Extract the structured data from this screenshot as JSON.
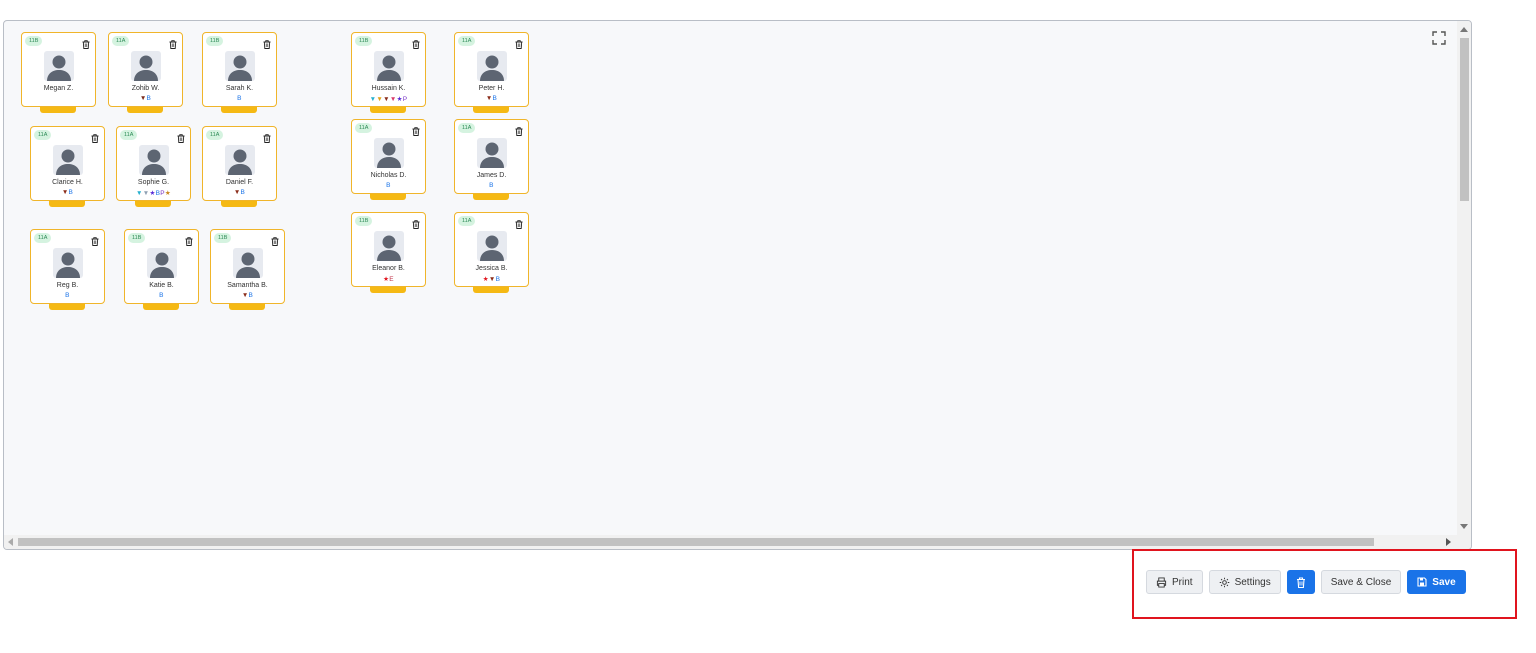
{
  "footer": {
    "print_label": "Print",
    "settings_label": "Settings",
    "delete_label": "",
    "save_close_label": "Save & Close",
    "save_label": "Save"
  },
  "icons": {
    "fullscreen": "fullscreen-icon",
    "trash": "trash-icon",
    "print": "printer-icon",
    "settings": "gear-icon",
    "save": "floppy-disk-icon",
    "avatar": "person-silhouette-icon"
  },
  "colors": {
    "card_border": "#f0b52a",
    "card_tab": "#f5b914",
    "class_badge_bg": "#d5f3e0",
    "class_badge_text": "#2c8a55",
    "primary_button": "#1a73e8",
    "highlight_box": "#e0141e",
    "tag_b": "#1a73e8",
    "tag_p": "#7a35c6",
    "tag_e": "#c0334a"
  },
  "students": [
    {
      "class": "11B",
      "name": "Megan Z.",
      "tags": []
    },
    {
      "class": "11A",
      "name": "Zohib W.",
      "tags": [
        {
          "t": "▼",
          "c": "#7a2b1c"
        },
        {
          "t": "B",
          "c": "#1a73e8"
        }
      ]
    },
    {
      "class": "11B",
      "name": "Sarah K.",
      "tags": [
        {
          "t": "B",
          "c": "#1a73e8"
        }
      ]
    },
    {
      "class": "11B",
      "name": "Hussain K.",
      "tags": [
        {
          "t": "▼",
          "c": "#27b0cf"
        },
        {
          "t": "▼",
          "c": "#e3a319"
        },
        {
          "t": "▼",
          "c": "#8a2c1a"
        },
        {
          "t": "▼",
          "c": "#d83a6a"
        },
        {
          "t": "★",
          "c": "#5a2bd6"
        },
        {
          "t": "P",
          "c": "#7a35c6"
        }
      ]
    },
    {
      "class": "11A",
      "name": "Peter H.",
      "tags": [
        {
          "t": "▼",
          "c": "#8a2c1a"
        },
        {
          "t": "B",
          "c": "#1a73e8"
        }
      ]
    },
    {
      "class": "11A",
      "name": "Clarice H.",
      "tags": [
        {
          "t": "▼",
          "c": "#8a2c1a"
        },
        {
          "t": "B",
          "c": "#1a73e8"
        }
      ]
    },
    {
      "class": "11A",
      "name": "Sophie G.",
      "tags": [
        {
          "t": "▼",
          "c": "#27b0cf"
        },
        {
          "t": "▼",
          "c": "#8fa0b3"
        },
        {
          "t": "★",
          "c": "#5a2bd6"
        },
        {
          "t": "B",
          "c": "#1a73e8"
        },
        {
          "t": "P",
          "c": "#7a35c6"
        },
        {
          "t": "★",
          "c": "#c8861d"
        }
      ]
    },
    {
      "class": "11A",
      "name": "Daniel F.",
      "tags": [
        {
          "t": "▼",
          "c": "#8a2c1a"
        },
        {
          "t": "B",
          "c": "#1a73e8"
        }
      ]
    },
    {
      "class": "11A",
      "name": "Nicholas D.",
      "tags": [
        {
          "t": "B",
          "c": "#1a73e8"
        }
      ]
    },
    {
      "class": "11A",
      "name": "James D.",
      "tags": [
        {
          "t": "B",
          "c": "#1a73e8"
        }
      ]
    },
    {
      "class": "11A",
      "name": "Reg B.",
      "tags": [
        {
          "t": "B",
          "c": "#1a73e8"
        }
      ]
    },
    {
      "class": "11B",
      "name": "Katie B.",
      "tags": [
        {
          "t": "B",
          "c": "#1a73e8"
        }
      ]
    },
    {
      "class": "11B",
      "name": "Samantha B.",
      "tags": [
        {
          "t": "▼",
          "c": "#8a2c1a"
        },
        {
          "t": "B",
          "c": "#1a73e8"
        }
      ]
    },
    {
      "class": "11B",
      "name": "Eleanor B.",
      "tags": [
        {
          "t": "★",
          "c": "#e0141e"
        },
        {
          "t": "E",
          "c": "#c0334a"
        }
      ]
    },
    {
      "class": "11A",
      "name": "Jessica B.",
      "tags": [
        {
          "t": "★",
          "c": "#e0141e"
        },
        {
          "t": "▼",
          "c": "#8a2c1a"
        },
        {
          "t": "B",
          "c": "#1a73e8"
        }
      ]
    }
  ]
}
